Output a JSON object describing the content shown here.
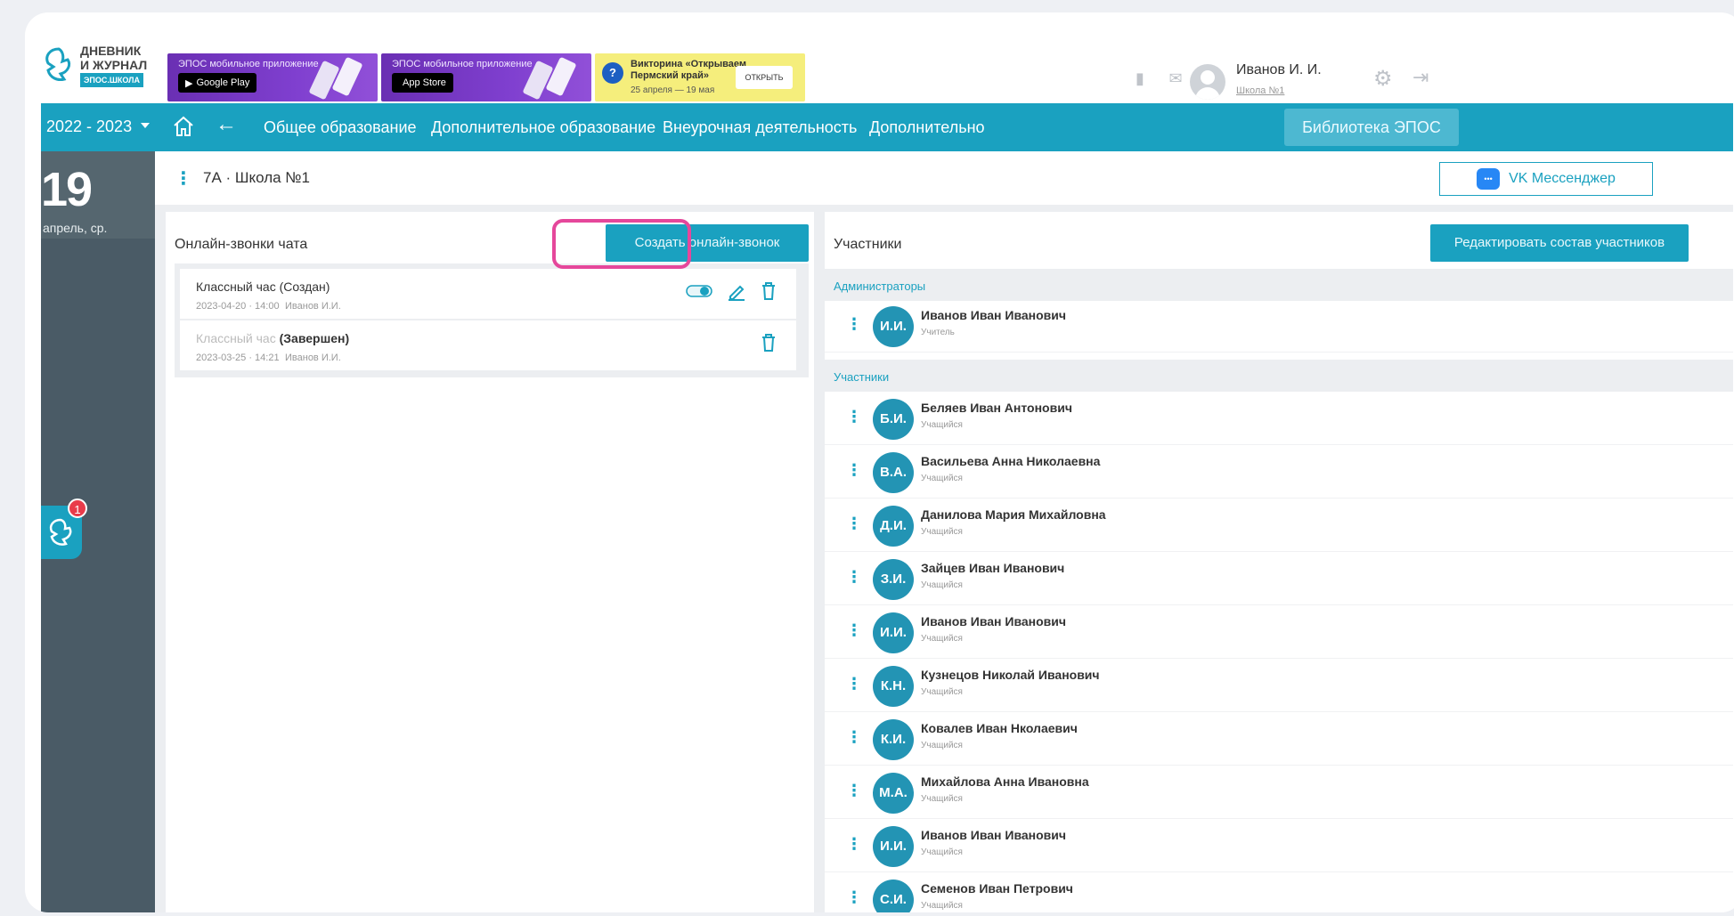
{
  "logo": {
    "line1": "ДНЕВНИК",
    "line2": "И ЖУРНАЛ",
    "line3": "ЭПОС.ШКОЛА"
  },
  "promos": [
    {
      "title": "ЭПОС мобильное приложение",
      "store": "Google Play"
    },
    {
      "title": "ЭПОС мобильное приложение",
      "store": "App Store"
    }
  ],
  "quiz": {
    "text": "Викторина «Открываем Пермский край»",
    "date": "25 апреля — 19 мая",
    "button": "ОТКРЫТЬ"
  },
  "user": {
    "name": "Иванов И. И.",
    "school": "Школа №1"
  },
  "nav": {
    "year": "2022 - 2023",
    "items": [
      "Общее образование",
      "Дополнительное образование",
      "Внеурочная деятельность",
      "Дополнительно"
    ],
    "library": "Библиотека ЭПОС"
  },
  "rail": {
    "day": "19",
    "dayname": "апрель, ср.",
    "badge": "1"
  },
  "chat": {
    "title": "7А · Школа №1",
    "vk": "VK Мессенджер"
  },
  "calls_panel": {
    "title": "Онлайн-звонки чата",
    "create": "Создать онлайн-звонок",
    "calls": [
      {
        "name": "Классный час",
        "status": "(Создан)",
        "date": "2023-04-20 · 14:00",
        "author": "Иванов И.И."
      },
      {
        "name": "Классный час",
        "status": "(Завершен)",
        "date": "2023-03-25 · 14:21",
        "author": "Иванов И.И."
      }
    ]
  },
  "members_panel": {
    "title": "Участники",
    "edit": "Редактировать состав участников",
    "admins_label": "Администраторы",
    "admins": [
      {
        "initials": "И.И.",
        "name": "Иванов Иван Иванович",
        "role": "Учитель"
      }
    ],
    "members_label": "Участники",
    "members": [
      {
        "initials": "Б.И.",
        "name": "Беляев Иван Антонович",
        "role": "Учащийся"
      },
      {
        "initials": "В.А.",
        "name": "Васильева Анна Николаевна",
        "role": "Учащийся"
      },
      {
        "initials": "Д.И.",
        "name": "Данилова Мария Михайловна",
        "role": "Учащийся"
      },
      {
        "initials": "З.И.",
        "name": "Зайцев Иван Иванович",
        "role": "Учащийся"
      },
      {
        "initials": "И.И.",
        "name": "Иванов Иван Иванович",
        "role": "Учащийся"
      },
      {
        "initials": "К.Н.",
        "name": "Кузнецов Николай Иванович",
        "role": "Учащийся"
      },
      {
        "initials": "К.И.",
        "name": "Ковалев Иван Нколаевич",
        "role": "Учащийся"
      },
      {
        "initials": "М.А.",
        "name": "Михайлова Анна Ивановна",
        "role": "Учащийся"
      },
      {
        "initials": "И.И.",
        "name": "Иванов Иван Иванович",
        "role": "Учащийся"
      },
      {
        "initials": "С.И.",
        "name": "Семенов Иван Петрович",
        "role": "Учащийся"
      }
    ]
  },
  "colors": {
    "accent": "#1aa1c0",
    "rail": "#4a5b66",
    "highlight": "#e5479b",
    "badge": "#e93b4a"
  }
}
